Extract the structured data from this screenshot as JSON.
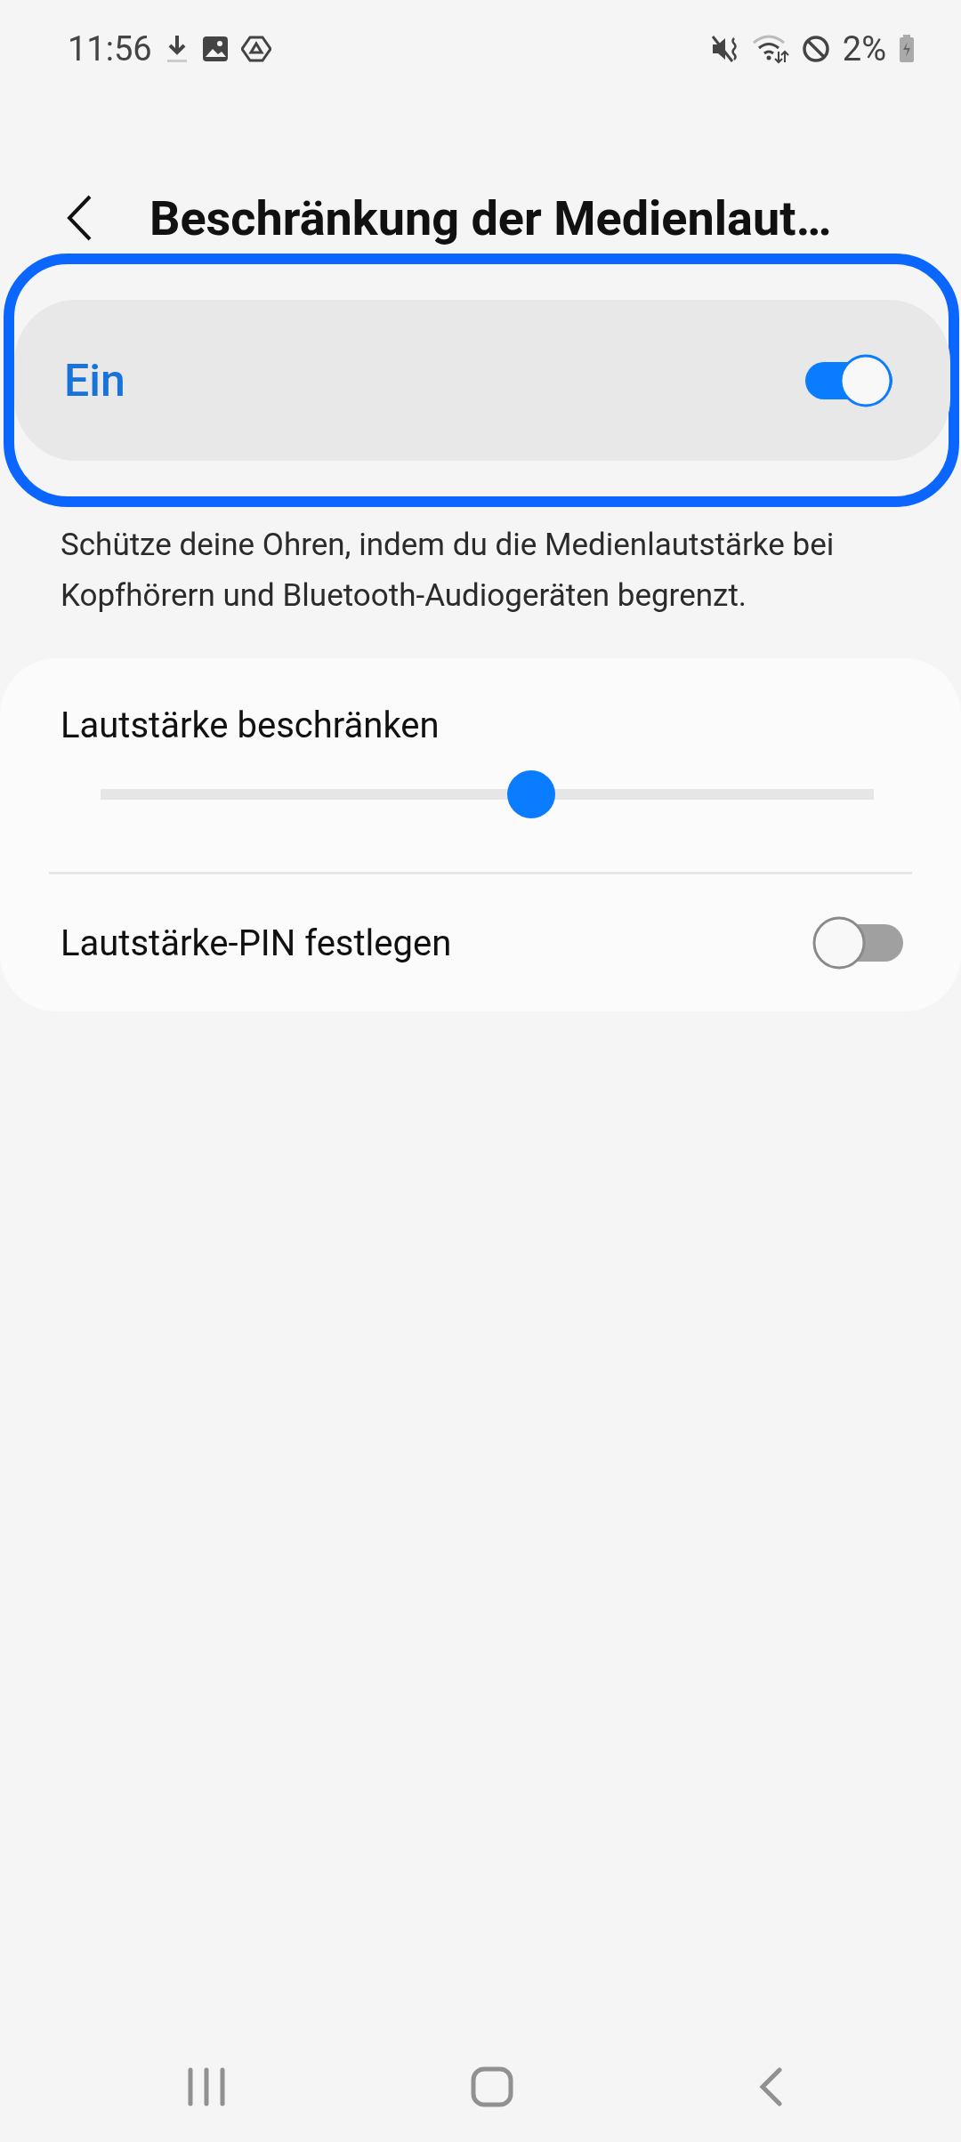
{
  "status_bar": {
    "time": "11:56",
    "battery": "2%"
  },
  "header": {
    "title": "Beschränkung der Medienlaut…"
  },
  "main_switch": {
    "label": "Ein",
    "on": true
  },
  "description": "Schütze deine Ohren, indem du die Medienlautstärke bei Kopfhörern und Bluetooth-Audiogeräten begrenzt.",
  "volume_limit": {
    "label": "Lautstärke beschränken",
    "level": 0.557
  },
  "volume_pin": {
    "label": "Lautstärke-PIN festlegen",
    "on": false
  }
}
